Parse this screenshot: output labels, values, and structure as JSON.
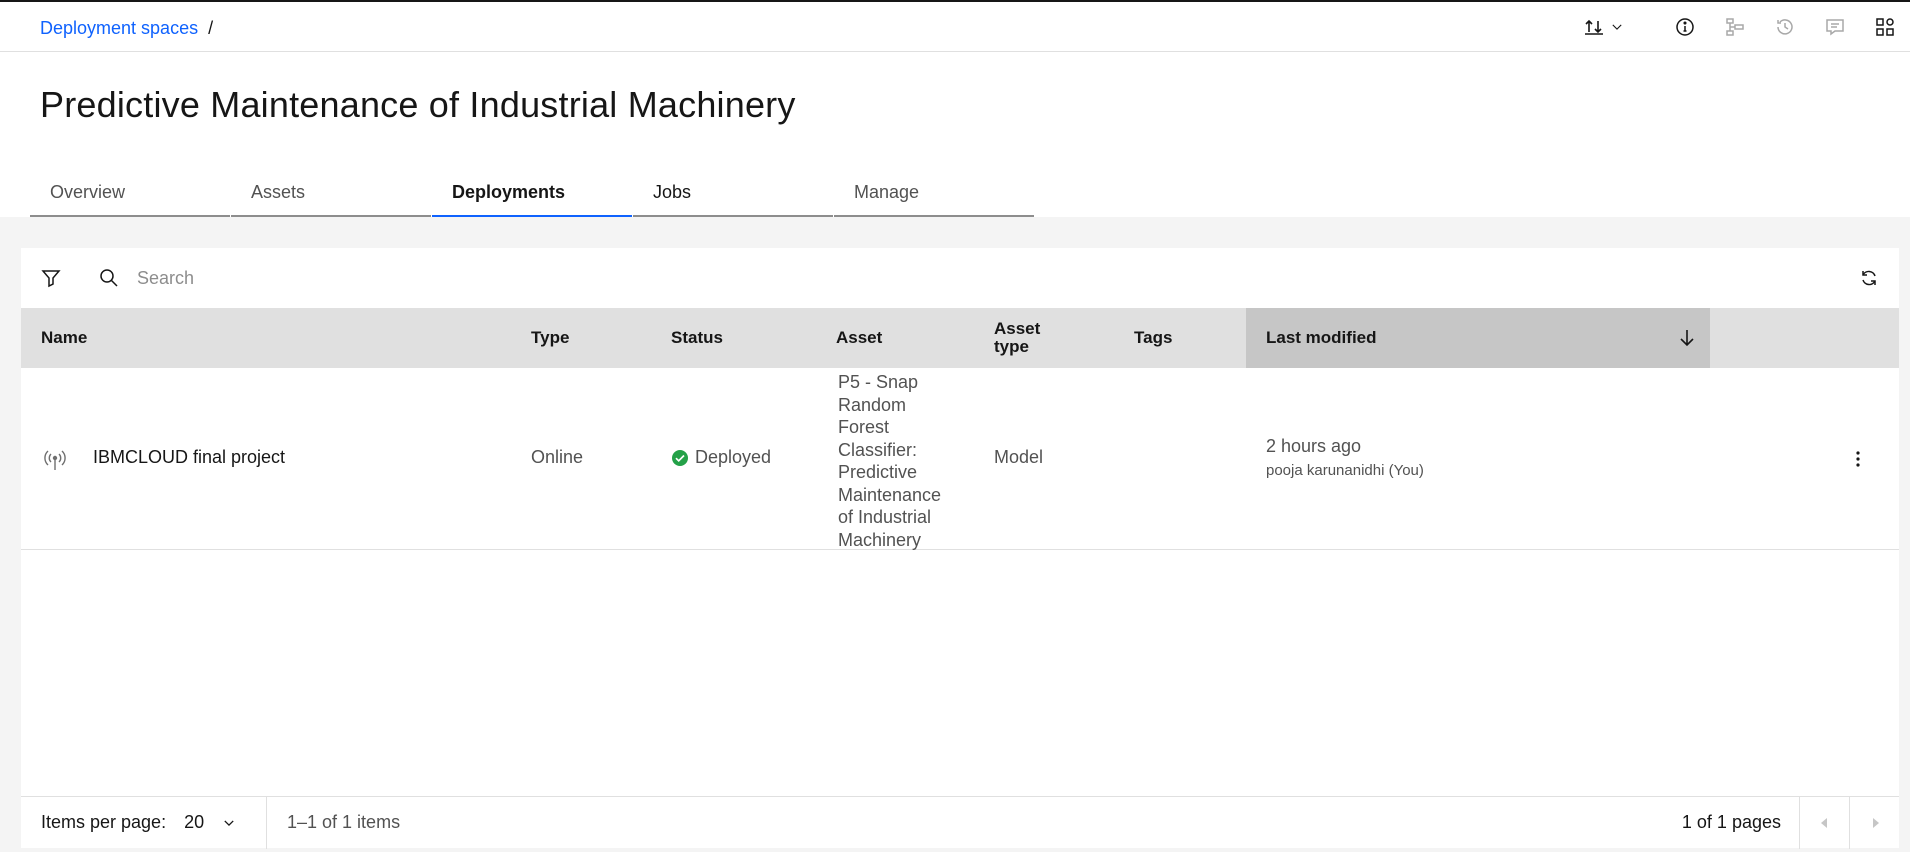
{
  "breadcrumb": {
    "parent": "Deployment spaces",
    "separator": "/"
  },
  "page": {
    "title": "Predictive Maintenance of Industrial Machinery"
  },
  "tabs": [
    {
      "label": "Overview",
      "active": false
    },
    {
      "label": "Assets",
      "active": false
    },
    {
      "label": "Deployments",
      "active": true
    },
    {
      "label": "Jobs",
      "active": false
    },
    {
      "label": "Manage",
      "active": false
    }
  ],
  "search": {
    "placeholder": "Search",
    "value": ""
  },
  "table": {
    "columns": {
      "name": "Name",
      "type": "Type",
      "status": "Status",
      "asset": "Asset",
      "asset_type": "Asset type",
      "tags": "Tags",
      "last_modified": "Last modified"
    },
    "sort": {
      "column": "last_modified",
      "direction": "descending"
    },
    "rows": [
      {
        "name": "IBMCLOUD final project",
        "type": "Online",
        "status": "Deployed",
        "asset": "P5 - Snap Random Forest Classifier: Predictive Maintenance of Industrial Machinery",
        "asset_type": "Model",
        "tags": "",
        "modified_time": "2 hours ago",
        "modified_by": "pooja karunanidhi (You)"
      }
    ]
  },
  "pagination": {
    "items_per_page_label": "Items per page:",
    "items_per_page": "20",
    "range": "1–1 of 1 items",
    "pages": "1 of 1 pages"
  },
  "colors": {
    "link": "#0f62fe",
    "success": "#24a148",
    "active_tab": "#0f62fe"
  }
}
